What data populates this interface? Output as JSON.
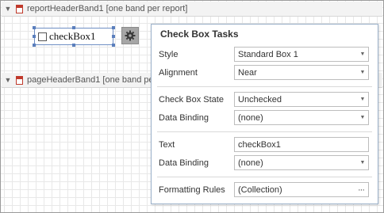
{
  "bands": {
    "report_header": "reportHeaderBand1 [one band per report]",
    "page_header": "pageHeaderBand1 [one band per page]"
  },
  "control": {
    "checkbox_label": "checkBox1"
  },
  "tasks": {
    "title": "Check Box Tasks",
    "style": {
      "label": "Style",
      "value": "Standard Box 1"
    },
    "alignment": {
      "label": "Alignment",
      "value": "Near"
    },
    "check_box_state": {
      "label": "Check Box State",
      "value": "Unchecked"
    },
    "state_binding": {
      "label": "Data Binding",
      "value": "(none)"
    },
    "text": {
      "label": "Text",
      "value": "checkBox1"
    },
    "text_binding": {
      "label": "Data Binding",
      "value": "(none)"
    },
    "formatting_rules": {
      "label": "Formatting Rules",
      "value": "(Collection)"
    }
  },
  "colors": {
    "selection": "#5b7fbd",
    "band_icon": "#c0392b",
    "panel_border": "#9ab0c9"
  }
}
